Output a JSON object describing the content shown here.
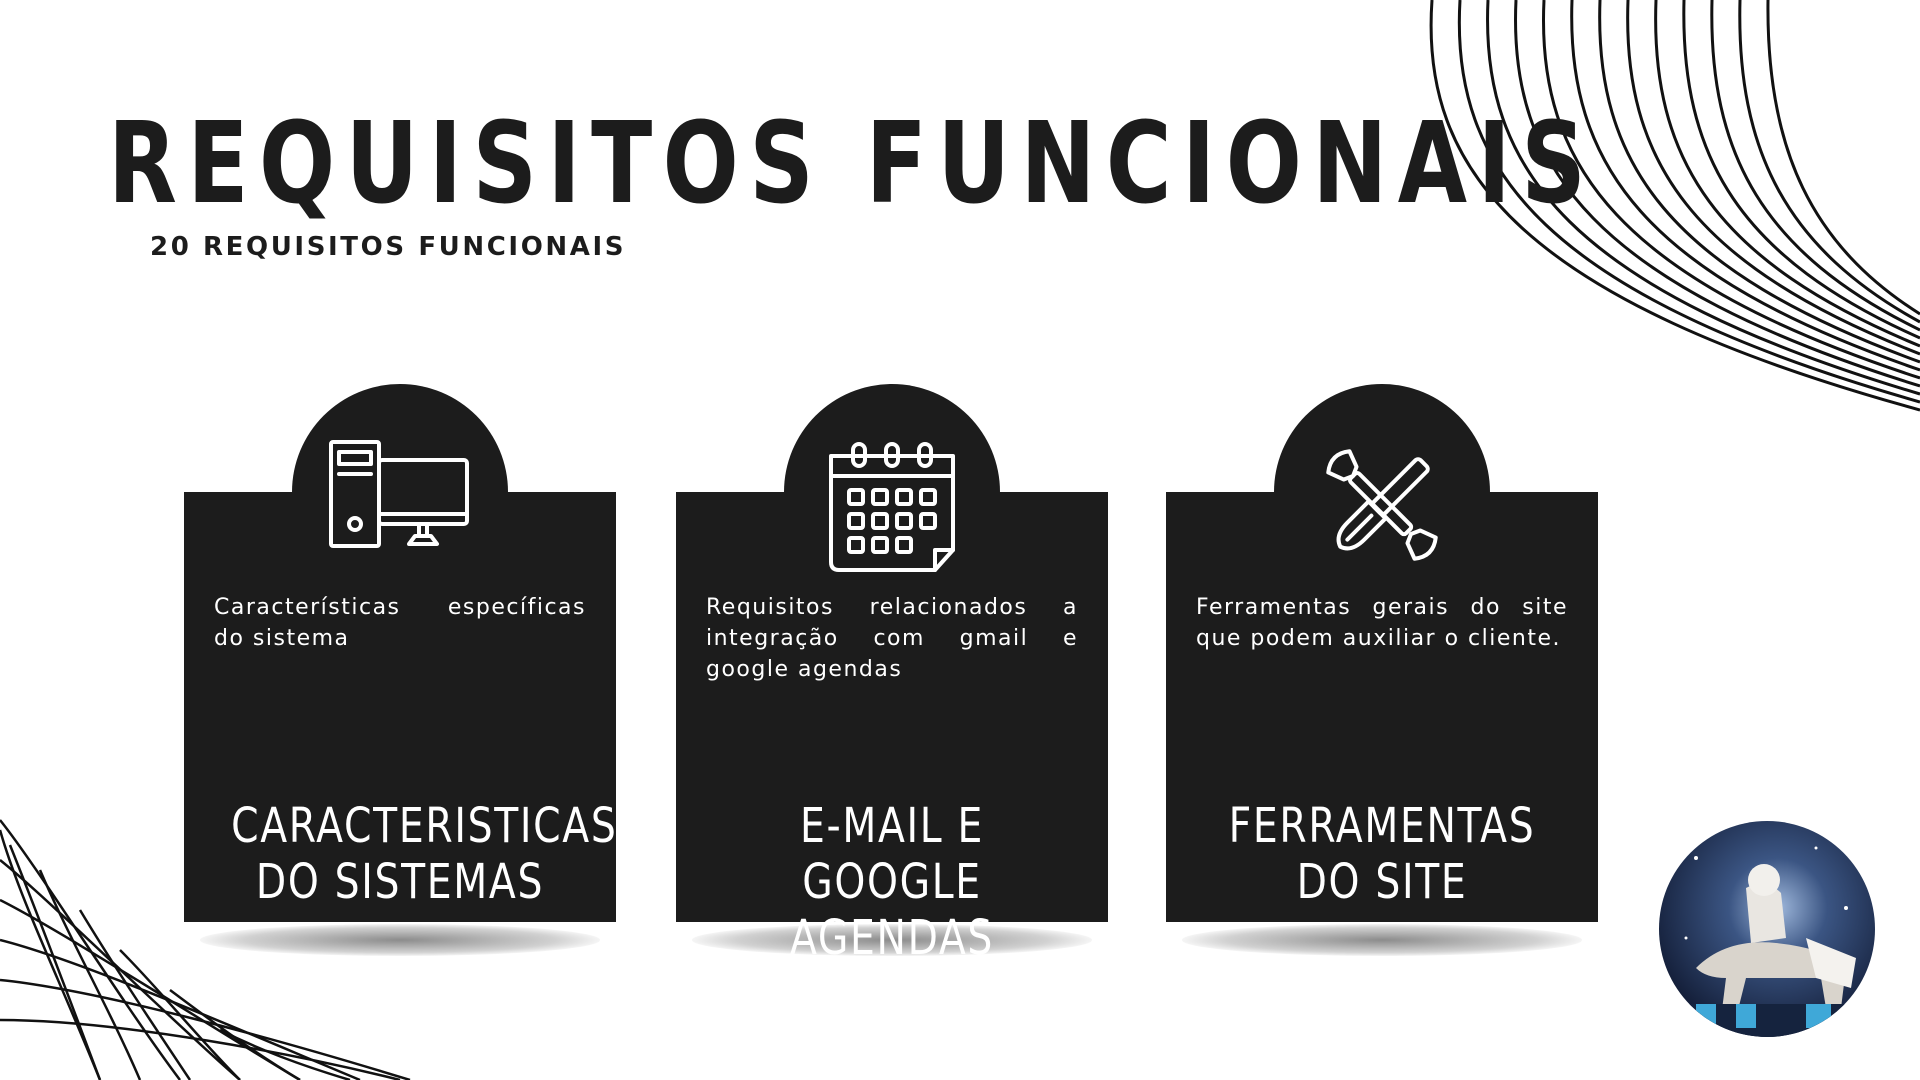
{
  "title": "REQUISITOS FUNCIONAIS",
  "subtitle": "20 REQUISITOS FUNCIONAIS",
  "cards": [
    {
      "icon": "computer-icon",
      "description": "Características específicas do sistema",
      "heading": "CARACTERISTICAS DO SISTEMAS"
    },
    {
      "icon": "calendar-icon",
      "description": "Requisitos relacionados a integração com gmail e google agendas",
      "heading": "E-MAIL E GOOGLE AGENDAS"
    },
    {
      "icon": "tools-icon",
      "description": "Ferramentas gerais do site que podem auxiliar o cliente.",
      "heading": "FERRAMENTAS DO SITE"
    }
  ],
  "colors": {
    "background": "#ffffff",
    "card": "#1c1c1c",
    "text_dark": "#1c1c1c",
    "text_light": "#ffffff"
  }
}
